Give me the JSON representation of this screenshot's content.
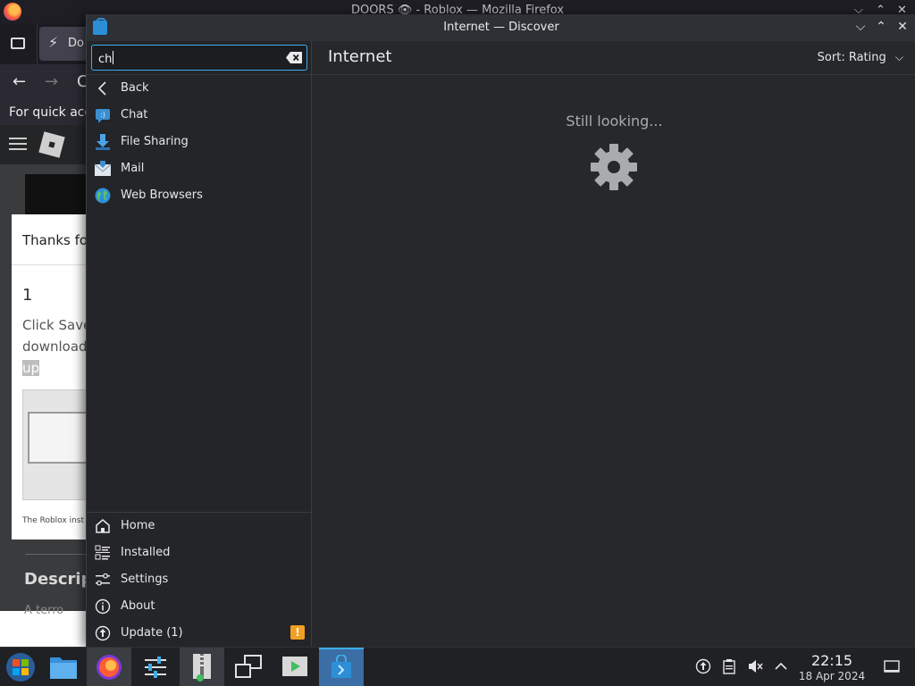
{
  "firefox": {
    "window_title": "DOORS 👁 - Roblox — Mozilla Firefox",
    "tab_label": "Do",
    "bookmarks_hint": "For quick acc",
    "page": {
      "thanks": "Thanks fo",
      "step_number": "1",
      "step_line1": "Click Save",
      "step_line2": "download",
      "step_line3": "up",
      "caption": "The Roblox inst",
      "description_heading": "Descrip",
      "description_text": "A terro"
    }
  },
  "discover": {
    "window_title": "Internet — Discover",
    "search": {
      "value": "ch"
    },
    "categories": [
      {
        "label": "Back",
        "icon": "chevron-left-icon"
      },
      {
        "label": "Chat",
        "icon": "chat-icon"
      },
      {
        "label": "File Sharing",
        "icon": "file-sharing-icon"
      },
      {
        "label": "Mail",
        "icon": "mail-icon"
      },
      {
        "label": "Web Browsers",
        "icon": "globe-icon"
      }
    ],
    "bottom_nav": [
      {
        "label": "Home",
        "icon": "home-icon"
      },
      {
        "label": "Installed",
        "icon": "installed-icon"
      },
      {
        "label": "Settings",
        "icon": "settings-sliders-icon"
      },
      {
        "label": "About",
        "icon": "info-icon"
      },
      {
        "label": "Update (1)",
        "icon": "update-icon",
        "badge": "!"
      }
    ],
    "main": {
      "title": "Internet",
      "sort_label": "Sort: Rating",
      "status": "Still looking..."
    },
    "colors": {
      "accent": "#3daee9",
      "badge": "#f29f24",
      "background": "#26282b"
    }
  },
  "taskbar": {
    "items": [
      {
        "name": "start-menu",
        "icon": "start-orb-icon"
      },
      {
        "name": "file-manager",
        "icon": "folder-icon"
      },
      {
        "name": "firefox",
        "icon": "firefox-icon"
      },
      {
        "name": "system-settings",
        "icon": "sliders-icon"
      },
      {
        "name": "archive-manager",
        "icon": "archive-icon"
      },
      {
        "name": "virtual-desktops",
        "icon": "desktops-icon"
      },
      {
        "name": "media-player",
        "icon": "media-player-icon"
      },
      {
        "name": "discover",
        "icon": "discover-bag-icon"
      }
    ],
    "clock": {
      "time": "22:15",
      "date": "18 Apr 2024"
    }
  }
}
